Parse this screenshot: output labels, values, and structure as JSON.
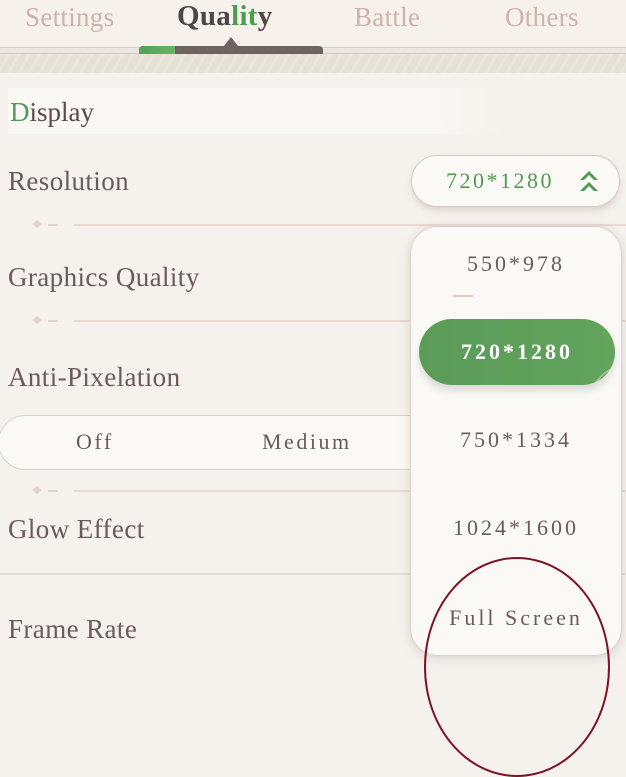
{
  "tabs": [
    {
      "label": "Settings",
      "active": false
    },
    {
      "label_prefix": "Qua",
      "label_green": "lit",
      "label_suffix": "y",
      "label": "Quality",
      "active": true
    },
    {
      "label": "Battle",
      "active": false
    },
    {
      "label": "Others",
      "active": false
    }
  ],
  "section": {
    "title_first": "D",
    "title_rest": "isplay"
  },
  "rows": {
    "resolution": {
      "label": "Resolution",
      "value": "720*1280",
      "icon": "double-chevron-up-icon"
    },
    "graphics_quality": {
      "label": "Graphics Quality"
    },
    "anti_pixelation": {
      "label": "Anti-Pixelation",
      "options": [
        "Off",
        "Medium"
      ]
    },
    "glow_effect": {
      "label": "Glow Effect"
    },
    "frame_rate": {
      "label": "Frame Rate"
    }
  },
  "resolution_dropdown": {
    "options": [
      "550*978",
      "720*1280",
      "750*1334",
      "1024*1600",
      "Full Screen"
    ],
    "selected": "720*1280"
  },
  "colors": {
    "accent_green": "#4e9b52",
    "selected_bg": "#5a9b58",
    "text": "#6b5a5c",
    "inactive_tab": "#cdb3ab",
    "annotation": "#7b1426"
  }
}
